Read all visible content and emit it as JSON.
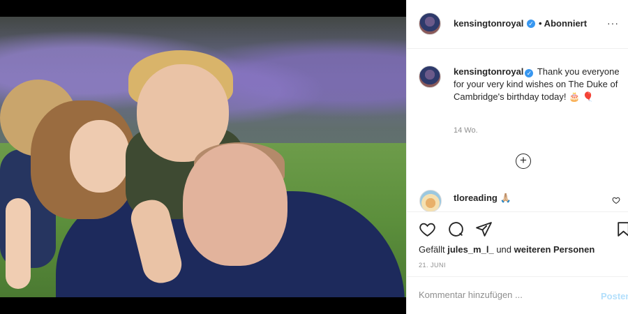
{
  "post": {
    "username": "kensingtonroyal",
    "follow_status": "• Abonniert",
    "more_icon": "···"
  },
  "caption": {
    "username": "kensingtonroyal",
    "text": "Thank you everyone for your very kind wishes on The Duke of Cambridge's birthday today!",
    "emojis": "🎂 🎈",
    "time_ago": "14 Wo."
  },
  "load_more": {
    "icon": "⊕"
  },
  "comment": {
    "username": "tloreading",
    "emojis": "🙏🏼"
  },
  "actions": {
    "liked_by_prefix": "Gefällt",
    "liked_by_user": "jules_m_l_",
    "liked_by_and": "und",
    "liked_by_others": "weiteren Personen",
    "date": "21. JUNI"
  },
  "comment_bar": {
    "placeholder": "Kommentar hinzufügen ...",
    "post_label": "Posten"
  },
  "colors": {
    "verified_blue": "#3897f0",
    "post_button_disabled": "#b2dffc",
    "text_primary": "#262626",
    "text_secondary": "#8e8e8e"
  }
}
